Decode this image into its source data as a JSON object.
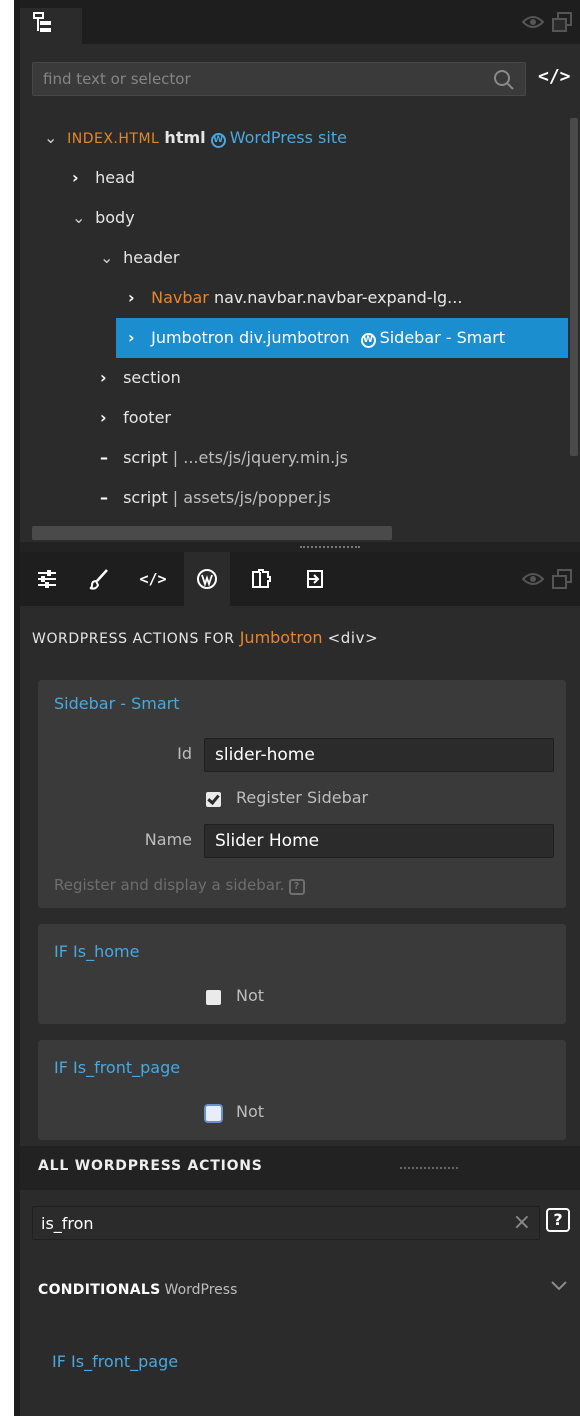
{
  "tree_panel": {
    "search": {
      "placeholder": "find text or selector",
      "value": ""
    },
    "code_toggle": "</>",
    "rows": [
      {
        "tag": "INDEX.HTML",
        "label": "html",
        "wp": "WordPress site"
      },
      {
        "label": "head"
      },
      {
        "label": "body"
      },
      {
        "label": "header"
      },
      {
        "name": "Navbar",
        "label": "nav.navbar.navbar-expand-lg..."
      },
      {
        "label": "Jumbotron div.jumbotron",
        "wp": "Sidebar - Smart"
      },
      {
        "label": "section"
      },
      {
        "label": "footer"
      },
      {
        "label": "script",
        "detail": "| ...ets/js/jquery.min.js"
      },
      {
        "label": "script",
        "detail": "| assets/js/popper.js"
      }
    ]
  },
  "properties": {
    "tabs": [
      "settings-sliders-icon",
      "brush-icon",
      "code-icon",
      "wordpress-icon",
      "puzzle-icon",
      "export-icon"
    ],
    "wp_actions": {
      "title_prefix": "WORDPRESS ACTIONS FOR",
      "element_name": "Jumbotron",
      "element_tag": "<div>"
    },
    "sidebar_card": {
      "title": "Sidebar - Smart",
      "id_label": "Id",
      "id_value": "slider-home",
      "register_label": "Register Sidebar",
      "register_checked": true,
      "name_label": "Name",
      "name_value": "Slider Home",
      "help": "Register and display a sidebar."
    },
    "is_home_card": {
      "title": "IF Is_home",
      "not_label": "Not",
      "checked": false
    },
    "is_front_card": {
      "title": "IF Is_front_page",
      "not_label": "Not",
      "checked": false
    }
  },
  "all_actions": {
    "title": "ALL WORDPRESS ACTIONS",
    "filter_value": "is_fron",
    "clear_glyph": "×",
    "help_glyph": "?",
    "section_title": "CONDITIONALS",
    "section_sub": "WordPress",
    "items": [
      "IF Is_front_page"
    ]
  },
  "colors": {
    "selection": "#1b8ecf",
    "accent_orange": "#e8852b",
    "link_blue": "#48a8e0",
    "panel_bg": "#2b2b2b"
  }
}
